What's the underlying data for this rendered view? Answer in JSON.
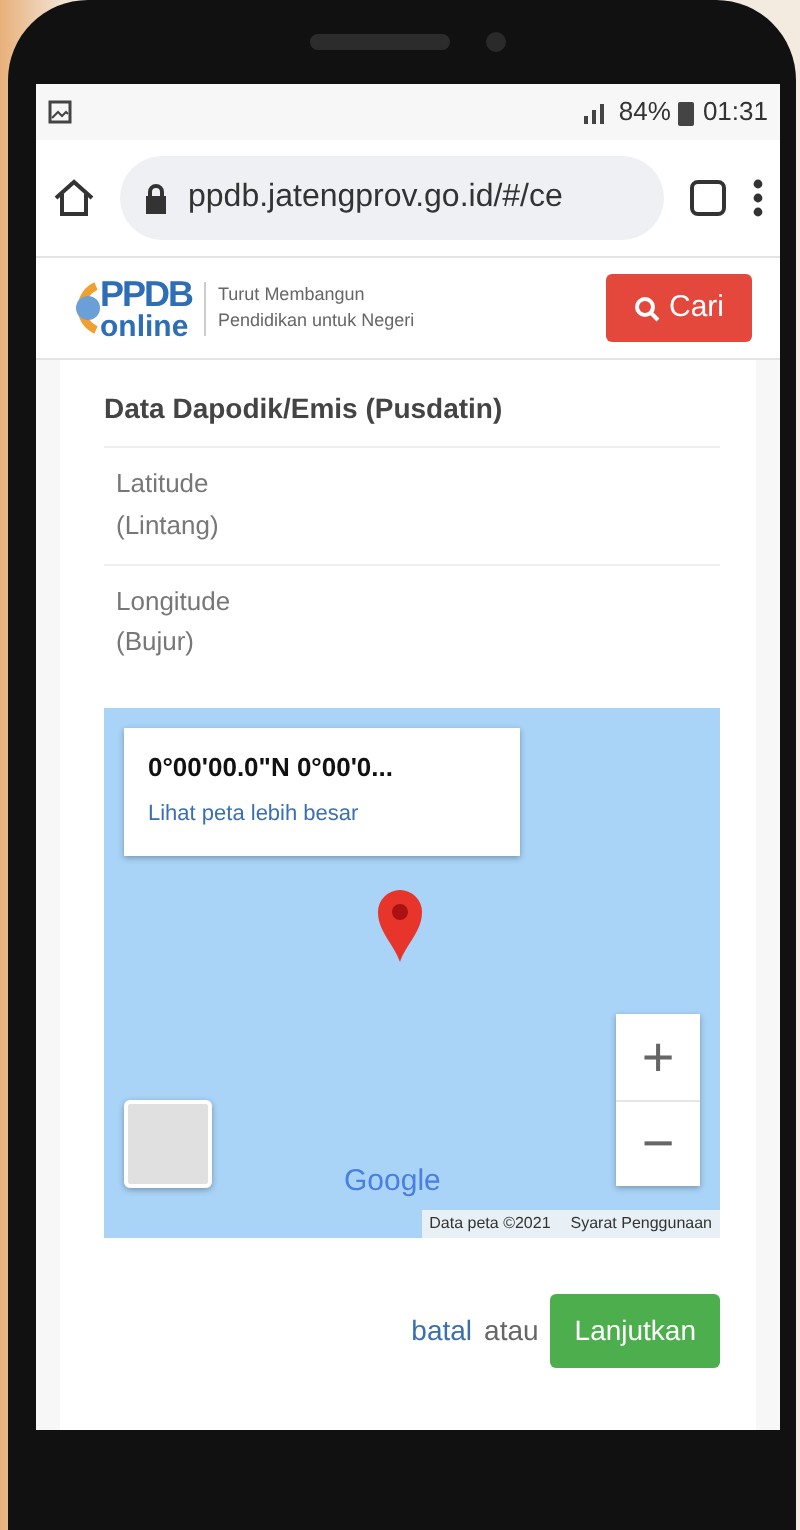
{
  "status_bar": {
    "battery": "84%",
    "time": "01:31"
  },
  "browser": {
    "url": "ppdb.jatengprov.go.id/#/ce"
  },
  "header": {
    "logo_top": "PPDB",
    "logo_bottom": "online",
    "tagline": [
      "Turut Membangun",
      "Pendidikan untuk Negeri"
    ],
    "search_button": "Cari"
  },
  "section": {
    "title": "Data Dapodik/Emis (Pusdatin)",
    "fields": [
      {
        "label": "Latitude",
        "sublabel": "(Lintang)"
      },
      {
        "label": "Longitude",
        "sublabel": "(Bujur)"
      }
    ]
  },
  "map": {
    "coordinates": "0°00'00.0\"N 0°00'0...",
    "larger_map_link": "Lihat peta lebih besar",
    "zoom_in": "+",
    "zoom_out": "−",
    "brand": "Google",
    "map_data": "Data peta ©2021",
    "terms": "Syarat Penggunaan"
  },
  "actions": {
    "cancel": "batal",
    "or": "atau",
    "continue": "Lanjutkan"
  }
}
